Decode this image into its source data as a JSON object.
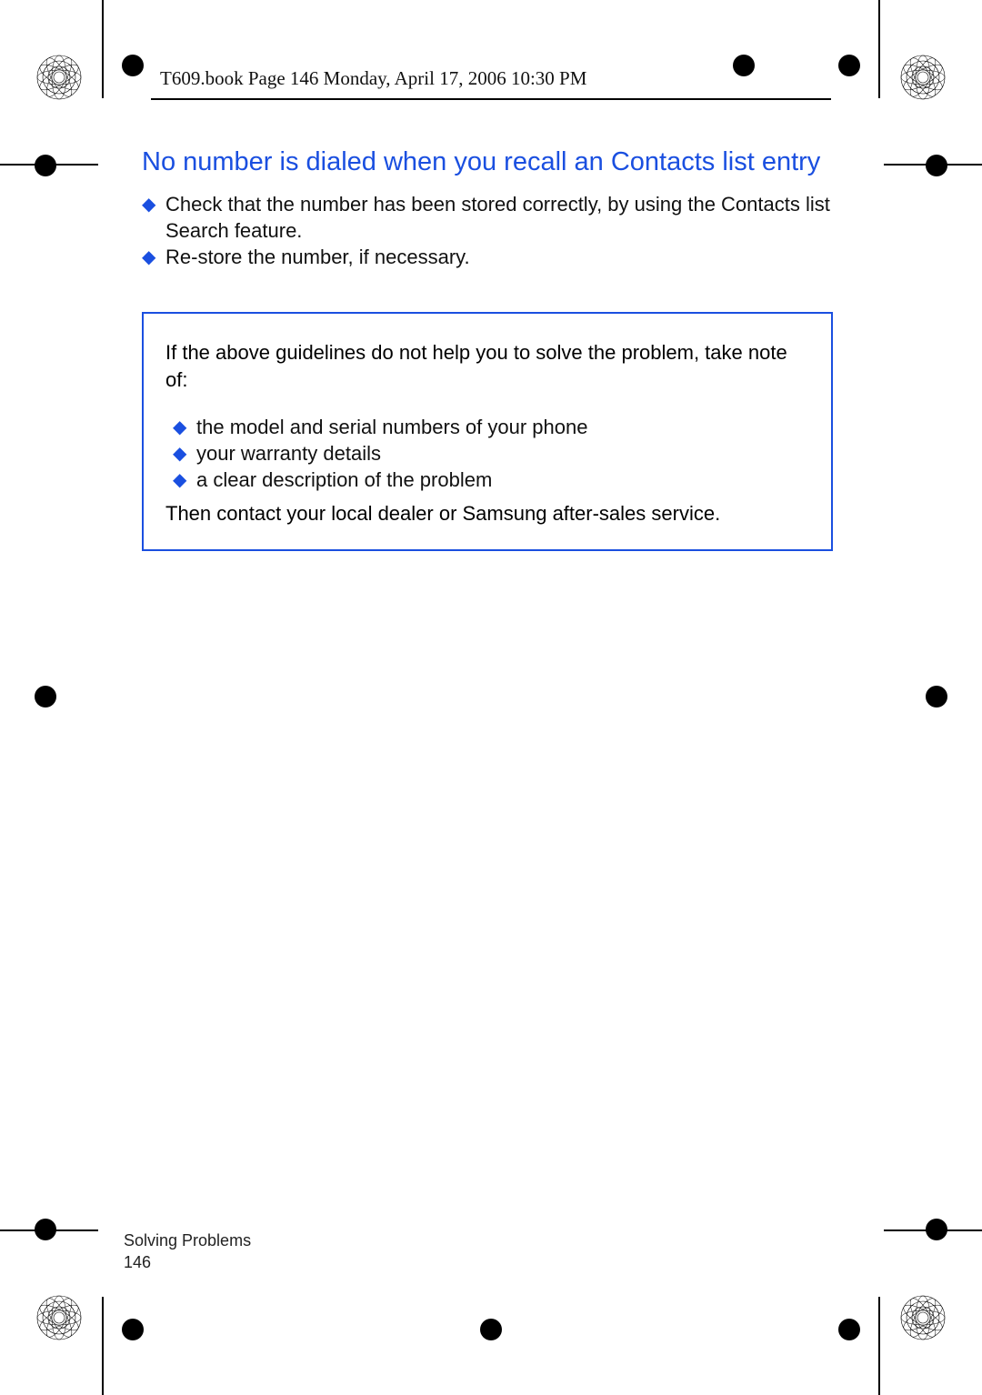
{
  "header": {
    "stamp": "T609.book  Page 146  Monday, April 17, 2006  10:30 PM"
  },
  "section": {
    "title": "No number is dialed when you recall an Contacts list entry",
    "bullets": [
      "Check that the number has been stored correctly, by using the Contacts list Search feature.",
      "Re-store the number, if necessary."
    ]
  },
  "note": {
    "intro": "If the above guidelines do not help you to solve the problem, take note of:",
    "items": [
      "the model and serial numbers of your phone",
      "your warranty details",
      "a clear description of the problem"
    ],
    "outro": "Then contact your local dealer or Samsung after-sales service."
  },
  "footer": {
    "chapter": "Solving Problems",
    "page": "146"
  }
}
